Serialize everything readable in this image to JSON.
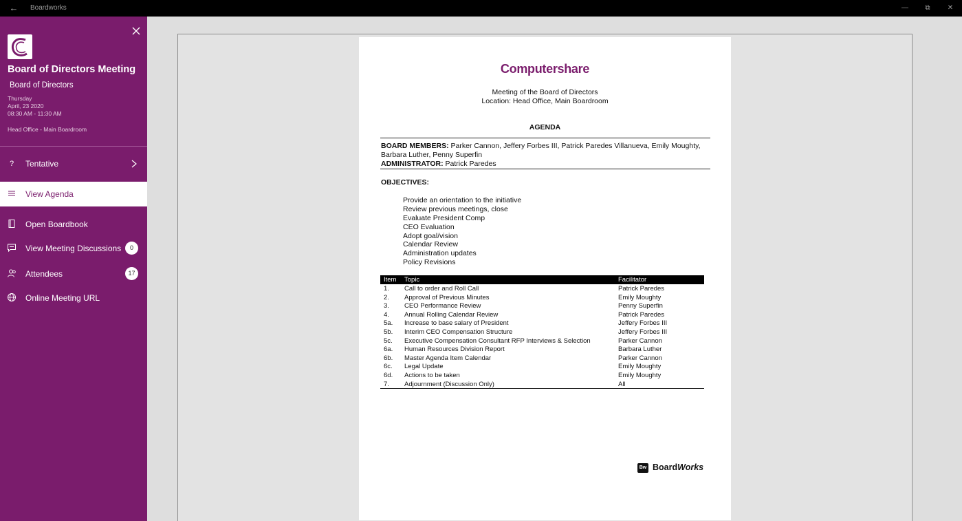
{
  "window": {
    "title": "Boardworks"
  },
  "sidebar": {
    "meeting_title": "Board of Directors Meeting",
    "board_name": "Board of Directors",
    "day": "Thursday",
    "date": "April, 23 2020",
    "time": "08:30 AM  -  11:30 AM",
    "location": "Head Office - Main Boardroom",
    "rsvp": {
      "label": "Tentative",
      "icon": "question-icon"
    },
    "nav": [
      {
        "label": "View Agenda",
        "icon": "list-icon",
        "active": true
      },
      {
        "label": "Open Boardbook",
        "icon": "book-icon",
        "active": false
      },
      {
        "label": "View Meeting Discussions",
        "icon": "chat-icon",
        "badge": "0"
      },
      {
        "label": "Attendees",
        "icon": "people-icon",
        "badge": "17"
      },
      {
        "label": "Online Meeting URL",
        "icon": "globe-icon"
      }
    ],
    "accent_color": "#7a1c6c"
  },
  "document": {
    "brand": "Computershare",
    "meeting_line": "Meeting of the Board of Directors",
    "location_line": "Location: Head Office, Main Boardroom",
    "heading": "AGENDA",
    "board_members_label": "BOARD MEMBERS:",
    "board_members_1": " Parker Cannon, Jeffery Forbes III, Patrick Paredes Villanueva, Emily Moughty,",
    "board_members_2": "Barbara Luther, Penny Superfin",
    "administrator_label": "ADMINISTRATOR:",
    "administrator": " Patrick Paredes",
    "objectives_label": "OBJECTIVES:",
    "objectives": [
      "Provide an orientation to the initiative",
      "Review previous meetings, close",
      "Evaluate President Comp",
      "CEO Evaluation",
      "Adopt goal/vision",
      "Calendar Review",
      "Administration updates",
      "Policy Revisions"
    ],
    "table": {
      "headers": [
        "Item",
        "Topic",
        "Facilitator"
      ],
      "rows": [
        [
          "1.",
          "Call to order and Roll Call",
          "Patrick Paredes"
        ],
        [
          "2.",
          "Approval of Previous Minutes",
          "Emily Moughty"
        ],
        [
          "3.",
          "CEO Performance Review",
          "Penny Superfin"
        ],
        [
          "4.",
          "Annual Rolling Calendar Review",
          "Patrick Paredes"
        ],
        [
          "5a.",
          "Increase to base salary of President",
          "Jeffery Forbes III"
        ],
        [
          "5b.",
          "Interim CEO Compensation Structure",
          "Jeffery Forbes III"
        ],
        [
          "5c.",
          "Executive Compensation Consultant RFP Interviews & Selection",
          "Parker Cannon"
        ],
        [
          "6a.",
          "Human Resources Division Report",
          "Barbara Luther"
        ],
        [
          "6b.",
          "Master Agenda Item Calendar",
          "Parker Cannon"
        ],
        [
          "6c.",
          "Legal Update",
          "Emily Moughty"
        ],
        [
          "6d.",
          "Actions to be taken",
          "Emily Moughty"
        ],
        [
          "7.",
          "Adjournment (Discussion Only)",
          "All"
        ]
      ]
    },
    "footer_logo_box": "Bw",
    "footer_logo_board": "Board",
    "footer_logo_works": "Works"
  }
}
